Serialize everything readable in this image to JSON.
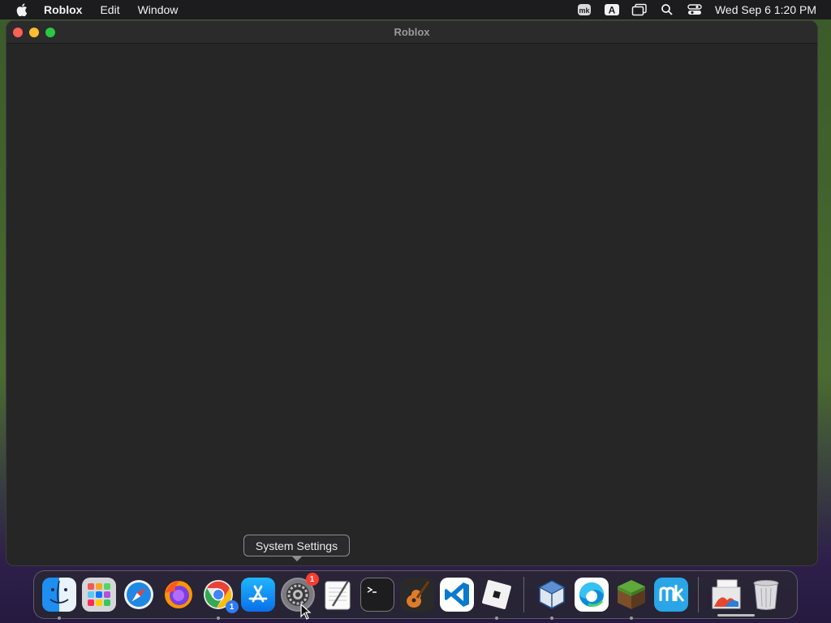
{
  "menubar": {
    "app_name": "Roblox",
    "items": [
      "Edit",
      "Window"
    ],
    "status_icons": [
      "mk-app-icon",
      "input-source-icon",
      "display-mirror-icon",
      "spotlight-search-icon",
      "control-center-icon"
    ],
    "input_source_label": "A",
    "mk_label": "mk",
    "clock": "Wed Sep 6  1:20 PM"
  },
  "window": {
    "title": "Roblox"
  },
  "tooltip": {
    "text": "System Settings"
  },
  "dock": {
    "apps": [
      {
        "name": "finder-icon",
        "running": true
      },
      {
        "name": "launchpad-icon",
        "running": false
      },
      {
        "name": "safari-icon",
        "running": false
      },
      {
        "name": "firefox-icon",
        "running": false
      },
      {
        "name": "chrome-icon",
        "running": true,
        "badge": "1"
      },
      {
        "name": "app-store-icon",
        "running": false
      },
      {
        "name": "system-settings-icon",
        "running": false,
        "badge": "1"
      },
      {
        "name": "textedit-icon",
        "running": false
      },
      {
        "name": "terminal-icon",
        "running": false
      },
      {
        "name": "garageband-icon",
        "running": false
      },
      {
        "name": "vscode-icon",
        "running": false
      },
      {
        "name": "roblox-icon",
        "running": true
      },
      {
        "name": "virtualbox-icon",
        "running": true
      },
      {
        "name": "edge-icon",
        "running": false
      },
      {
        "name": "minecraft-icon",
        "running": true
      },
      {
        "name": "mk-icon",
        "running": false
      },
      {
        "name": "downloads-stack-icon",
        "running": false
      },
      {
        "name": "trash-icon",
        "running": false
      }
    ]
  },
  "colors": {
    "menubar_bg": "#1c1c1e",
    "window_bg": "#262626",
    "close": "#ff5f57",
    "minimize": "#febc2e",
    "maximize": "#28c840",
    "badge": "#ff3b30"
  }
}
